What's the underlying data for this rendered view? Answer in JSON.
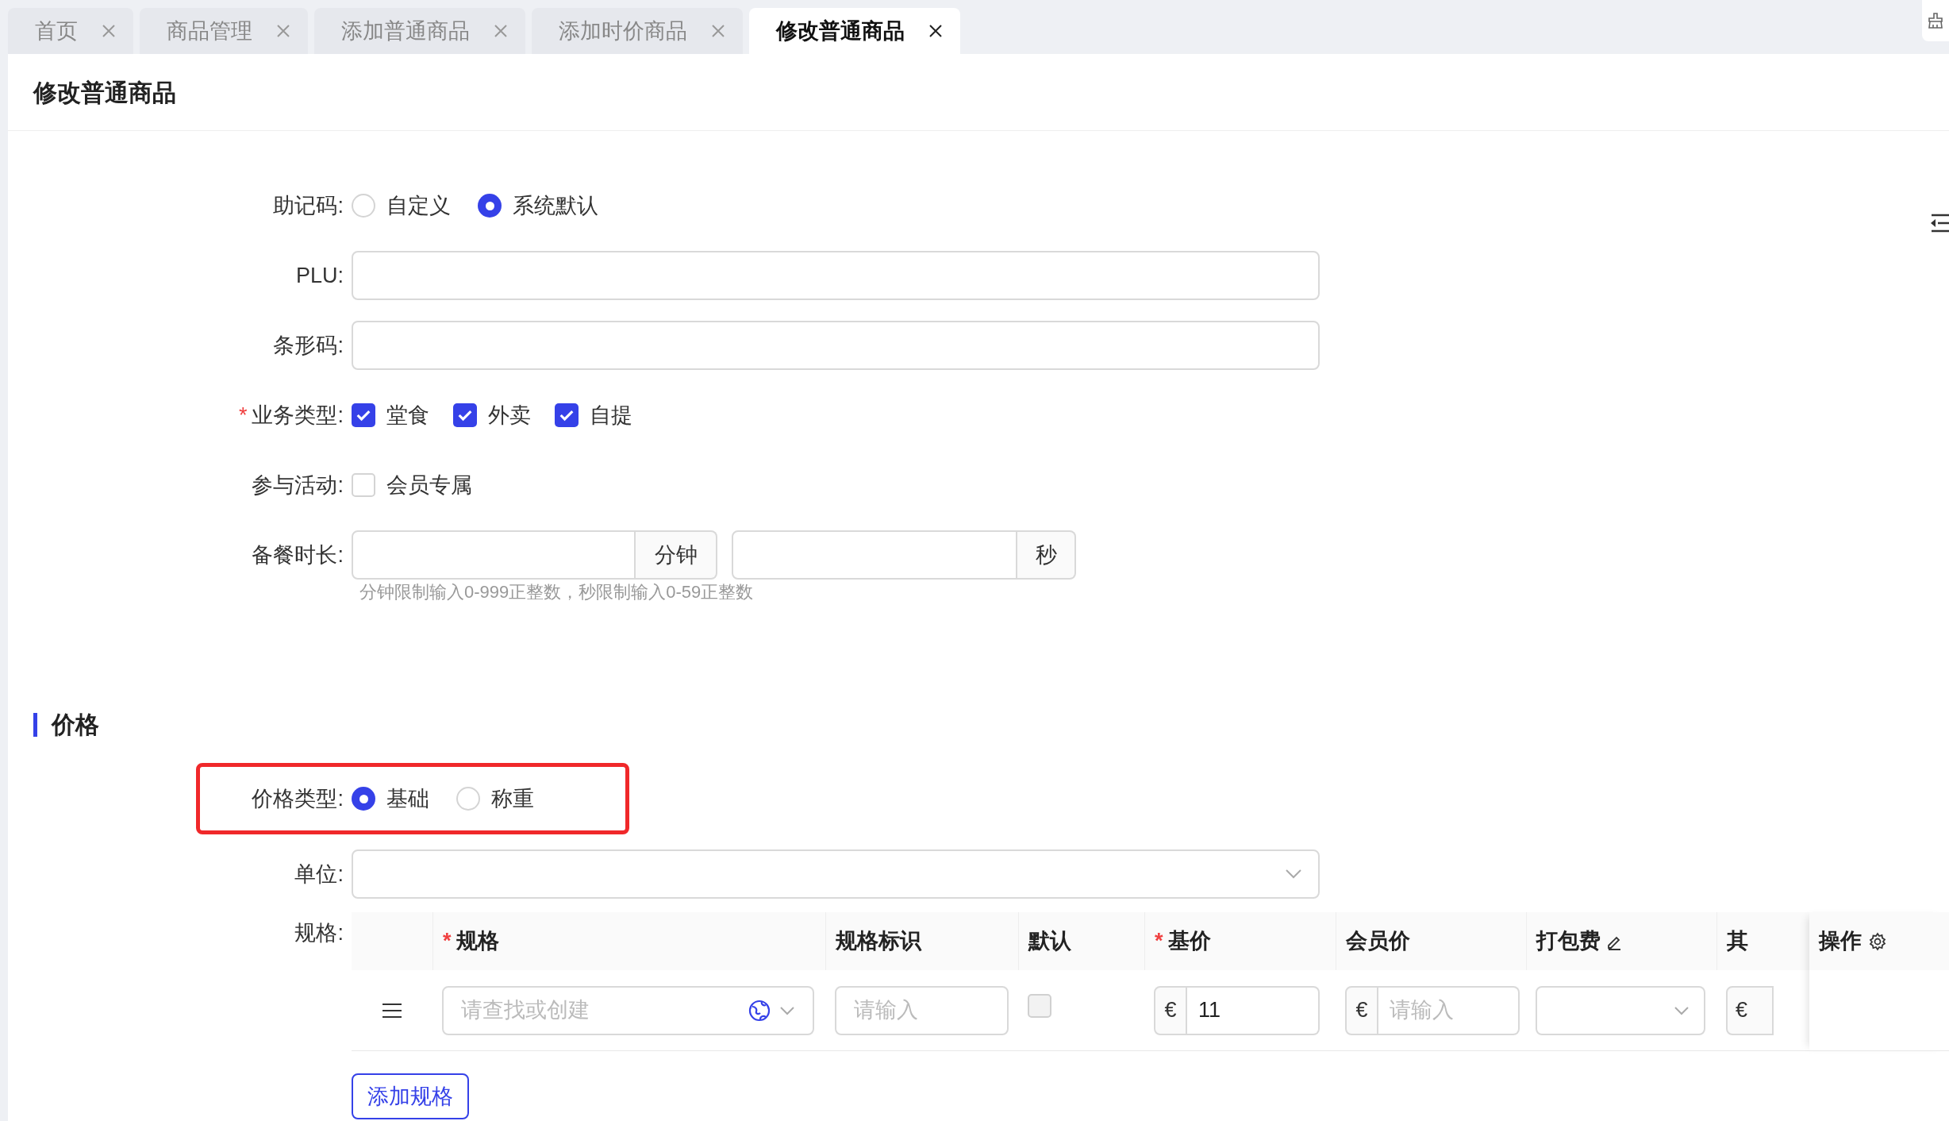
{
  "tabs": [
    {
      "label": "首页",
      "selected": false
    },
    {
      "label": "商品管理",
      "selected": false
    },
    {
      "label": "添加普通商品",
      "selected": false
    },
    {
      "label": "添加时价商品",
      "selected": false
    },
    {
      "label": "修改普通商品",
      "selected": true
    }
  ],
  "page_title": "修改普通商品",
  "form": {
    "mnemonic": {
      "label": "助记码:",
      "options": [
        {
          "label": "自定义",
          "selected": false
        },
        {
          "label": "系统默认",
          "selected": true
        }
      ]
    },
    "plu": {
      "label": "PLU:"
    },
    "barcode": {
      "label": "条形码:"
    },
    "business_type": {
      "label": "业务类型:",
      "required_mark": "*",
      "options": [
        {
          "label": "堂食",
          "checked": true
        },
        {
          "label": "外卖",
          "checked": true
        },
        {
          "label": "自提",
          "checked": true
        }
      ]
    },
    "activity": {
      "label": "参与活动:",
      "options": [
        {
          "label": "会员专属",
          "checked": false
        }
      ]
    },
    "prep_time": {
      "label": "备餐时长:",
      "minutes_unit": "分钟",
      "seconds_unit": "秒",
      "hint": "分钟限制输入0-999正整数，秒限制输入0-59正整数"
    }
  },
  "price_section": {
    "title": "价格",
    "price_type": {
      "label": "价格类型:",
      "highlighted": true,
      "options": [
        {
          "label": "基础",
          "selected": true
        },
        {
          "label": "称重",
          "selected": false
        }
      ]
    },
    "unit": {
      "label": "单位:"
    },
    "spec": {
      "label": "规格:",
      "columns": [
        {
          "label": "规格",
          "required_mark": "*"
        },
        {
          "label": "规格标识"
        },
        {
          "label": "默认"
        },
        {
          "label": "基价",
          "required_mark": "*"
        },
        {
          "label": "会员价"
        },
        {
          "label": "打包费",
          "editable": true
        },
        {
          "label": "其"
        }
      ],
      "action_column": "操作",
      "rows": [
        {
          "spec_placeholder": "请查找或创建",
          "tag_placeholder": "请输入",
          "default": {
            "checked": false,
            "disabled": true
          },
          "base_price": {
            "currency": "€",
            "value": "11"
          },
          "member_price": {
            "currency": "€",
            "placeholder": "请输入"
          },
          "other_currency": "€"
        }
      ],
      "add_button": "添加规格"
    }
  }
}
